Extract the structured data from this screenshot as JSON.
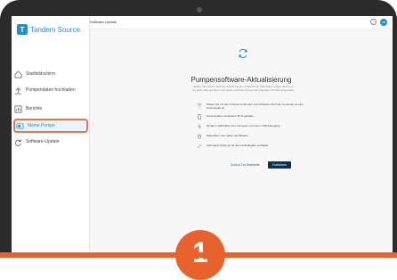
{
  "brand": {
    "name": "Tandem Source",
    "logo_letter": "T"
  },
  "topbar": {
    "title": "Software-Update",
    "help_label": "?",
    "avatar_initials": "AB"
  },
  "sidebar": {
    "items": [
      {
        "label": "Startbildschirm",
        "icon": "home-icon"
      },
      {
        "label": "Pumpendaten hochladen",
        "icon": "upload-icon"
      },
      {
        "label": "Berichte",
        "icon": "reports-icon"
      },
      {
        "label": "Meine Pumpe",
        "icon": "pump-icon",
        "selected": true
      },
      {
        "label": "Software-Update",
        "icon": "refresh-icon"
      }
    ]
  },
  "main": {
    "title": "Pumpensoftware-Aktualisierung",
    "intro": "Stellen Sie sicher, dass Sie Zugriff auf die vorhandenen Materialien haben. Bevor es los geht, bitte auf Ihrem Computer und Ihrer Pumpe die folgenden Schritte überprüfen.",
    "checklist": [
      {
        "text": "Stellen Sie mit dem Internet verbunden und schließen Sie Ihren Computer an eine Stromquelle an",
        "icon": "wifi-icon"
      },
      {
        "text": "Pumpenakku mindestens 50 % geladen",
        "icon": "battery-icon"
      },
      {
        "text": "Tandem USB-Kabel zum Computer mit einem USB-A Eingang",
        "icon": "usb-icon"
      },
      {
        "text": "Materialien zum Laden der Batterie",
        "icon": "charger-icon"
      },
      {
        "text": "Alternative Optionen für die Insulinabgabe verfügbar",
        "icon": "syringe-icon"
      }
    ],
    "back_label": "Zurück Zur Startseite",
    "continue_label": "Fortfahren"
  },
  "step_badge": "1",
  "colors": {
    "accent": "#1e8fd6",
    "highlight": "#e07a4a",
    "primary_button": "#0f2e52",
    "badge": "#e8622d"
  }
}
